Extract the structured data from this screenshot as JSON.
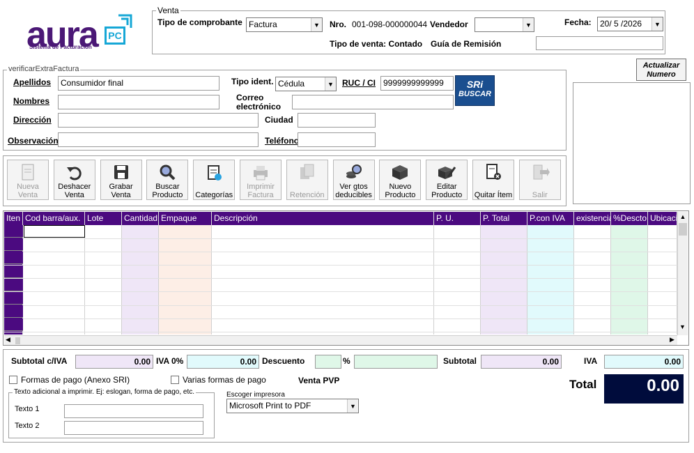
{
  "logo": {
    "word": "aura",
    "badge": "PC",
    "tagline": "Sistema de Facturación"
  },
  "venta": {
    "legend": "Venta",
    "tipo_comprobante_label": "Tipo de comprobante",
    "tipo_comprobante_value": "Factura",
    "nro_label": "Nro.",
    "nro_value": "001-098-000000044",
    "vendedor_label": "Vendedor",
    "vendedor_value": "",
    "fecha_label": "Fecha:",
    "fecha_value": "20/ 5 /2026",
    "tipo_venta_text": "Tipo de venta: Contado",
    "guia_label": "Guía de Remisión",
    "guia_value": ""
  },
  "actualizar_button": "Actualizar Numero",
  "cliente": {
    "legend": "verificarExtraFactura",
    "apellidos_label": "Apellidos",
    "apellidos_value": "Consumidor final",
    "tipo_ident_label": "Tipo ident.",
    "tipo_ident_value": "Cédula",
    "ruc_label": "RUC / CI",
    "ruc_value": "9999999999999",
    "nombres_label": "Nombres",
    "nombres_value": "",
    "correo_label": "Correo electrónico",
    "correo_value": "",
    "direccion_label": "Dirección",
    "direccion_value": "",
    "ciudad_label": "Ciudad",
    "ciudad_value": "",
    "observacion_label": "Observación",
    "observacion_value": "",
    "telefono_label": "Teléfono",
    "telefono_value": "",
    "sri_line1": "SRi",
    "sri_line2": "BUSCAR"
  },
  "toolbar": [
    {
      "line1": "Nueva",
      "line2": "Venta",
      "icon": "new-document-icon",
      "disabled": true
    },
    {
      "line1": "Deshacer",
      "line2": "Venta",
      "icon": "undo-icon",
      "disabled": false
    },
    {
      "line1": "Grabar",
      "line2": "Venta",
      "icon": "save-icon",
      "disabled": false
    },
    {
      "line1": "Buscar",
      "line2": "Producto",
      "icon": "search-icon",
      "disabled": false
    },
    {
      "line1": "",
      "line2": "Categorías",
      "icon": "clipboard-check-icon",
      "disabled": false
    },
    {
      "line1": "Imprimir",
      "line2": "Factura",
      "icon": "printer-icon",
      "disabled": true
    },
    {
      "line1": "",
      "line2": "Retención",
      "icon": "copy-document-icon",
      "disabled": true
    },
    {
      "line1": "Ver gtos",
      "line2": "deducibles",
      "icon": "coins-search-icon",
      "disabled": false
    },
    {
      "line1": "Nuevo",
      "line2": "Producto",
      "icon": "box-icon",
      "disabled": false
    },
    {
      "line1": "Editar",
      "line2": "Producto",
      "icon": "box-edit-icon",
      "disabled": false
    },
    {
      "line1": "",
      "line2": "Quitar Ítem",
      "icon": "remove-document-icon",
      "disabled": false
    },
    {
      "line1": "",
      "line2": "Salir",
      "icon": "exit-icon",
      "disabled": true
    }
  ],
  "grid": {
    "columns": [
      "Iten",
      "Cod barra/aux.",
      "Lote",
      "Cantidad",
      "Empaque",
      "Descripción",
      "P. U.",
      "P. Total",
      "P.con IVA",
      "existencia",
      "%Descto",
      "Ubicación"
    ],
    "column_tints": [
      "#4b0a80",
      "#ffffff",
      "#ffffff",
      "#efe6f7",
      "#fdeee6",
      "#ffffff",
      "#ffffff",
      "#efe6f7",
      "#e1fafc",
      "#ffffff",
      "#dff7e8",
      "#ffffff"
    ]
  },
  "totals": {
    "subtotal_civa_label": "Subtotal c/IVA",
    "subtotal_civa_value": "0.00",
    "iva0_label": "IVA 0%",
    "iva0_value": "0.00",
    "descuento_label": "Descuento",
    "descuento_value": "",
    "pct_symbol": "%",
    "descuento_pct_value": "",
    "subtotal_label": "Subtotal",
    "subtotal_value": "0.00",
    "iva_label": "IVA",
    "iva_value": "0.00",
    "total_label": "Total",
    "total_value": "0.00",
    "formas_pago_label": "Formas de pago (Anexo SRI)",
    "varias_formas_label": "Varias formas de pago",
    "venta_pvp": "Venta PVP",
    "texto_adicional_legend": "Texto adicional a imprimir. Ej: eslogan, forma de pago, etc.",
    "texto1_label": "Texto 1",
    "texto1_value": "",
    "texto2_label": "Texto 2",
    "texto2_value": "",
    "impresora_label": "Escoger impresora",
    "impresora_value": "Microsoft Print to PDF"
  },
  "colors": {
    "brand": "#4b1876",
    "accent": "#16a7d6",
    "grid_header": "#4b0a80",
    "total_bg": "#000c3c"
  }
}
